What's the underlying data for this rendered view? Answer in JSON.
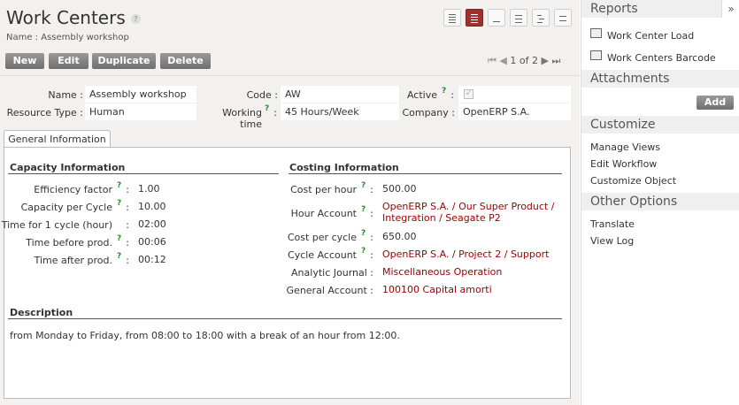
{
  "header": {
    "title": "Work Centers",
    "help": "?",
    "subtitle": "Name : Assembly workshop"
  },
  "toolbar": {
    "new_label": "New",
    "edit_label": "Edit",
    "duplicate_label": "Duplicate",
    "delete_label": "Delete",
    "pager": "1 of 2"
  },
  "view_switcher": [
    "list-view-icon",
    "form-view-icon",
    "graph-view-icon",
    "calendar-view-icon",
    "gantt-view-icon",
    "grid-view-icon"
  ],
  "record": {
    "name_label": "Name :",
    "name_value": "Assembly workshop",
    "code_label": "Code :",
    "code_value": "AW",
    "active_label": "Active",
    "active_colon": ":",
    "active_checked": true,
    "resource_type_label": "Resource Type :",
    "resource_type_value": "Human",
    "working_time_label": "Working time",
    "working_time_colon": ":",
    "working_time_value": "45 Hours/Week",
    "company_label": "Company :",
    "company_value": "OpenERP S.A.",
    "help_q": "?"
  },
  "tabs": [
    {
      "label": "General Information"
    }
  ],
  "capacity": {
    "heading": "Capacity Information",
    "rows": [
      {
        "label": "Efficiency factor",
        "value": "1.00"
      },
      {
        "label": "Capacity per Cycle",
        "value": "10.00"
      },
      {
        "label": "Time for 1 cycle (hour)",
        "value": "02:00"
      },
      {
        "label": "Time before prod.",
        "value": "00:06"
      },
      {
        "label": "Time after prod.",
        "value": "00:12"
      }
    ]
  },
  "costing": {
    "heading": "Costing Information",
    "cost_per_hour_label": "Cost per hour",
    "cost_per_hour_value": "500.00",
    "hour_account_label": "Hour Account",
    "hour_account_line1": "OpenERP S.A. / Our Super Product /",
    "hour_account_line2": "Integration / Seagate P2",
    "cost_per_cycle_label": "Cost per cycle",
    "cost_per_cycle_value": "650.00",
    "cycle_account_label": "Cycle Account",
    "cycle_account_value": "OpenERP S.A. / Project 2 / Support",
    "analytic_journal_label": "Analytic Journal :",
    "analytic_journal_value": "Miscellaneous Operation",
    "general_account_label": "General Account :",
    "general_account_value": "100100 Capital amorti",
    "colon": ":"
  },
  "description": {
    "heading": "Description",
    "text": "from Monday to Friday, from 08:00 to 18:00 with a break of an hour from 12:00."
  },
  "sidebar": {
    "collapse": "»",
    "reports_heading": "Reports",
    "reports": [
      "Work Center Load",
      "Work Centers Barcode"
    ],
    "attachments_heading": "Attachments",
    "add_label": "Add",
    "customize_heading": "Customize",
    "customize_items": [
      "Manage Views",
      "Edit Workflow",
      "Customize Object"
    ],
    "other_heading": "Other Options",
    "other_items": [
      "Translate",
      "View Log"
    ]
  },
  "colors": {
    "accent": "#a2312b",
    "link": "#9a0000",
    "help_green": "#2a8a2a"
  }
}
